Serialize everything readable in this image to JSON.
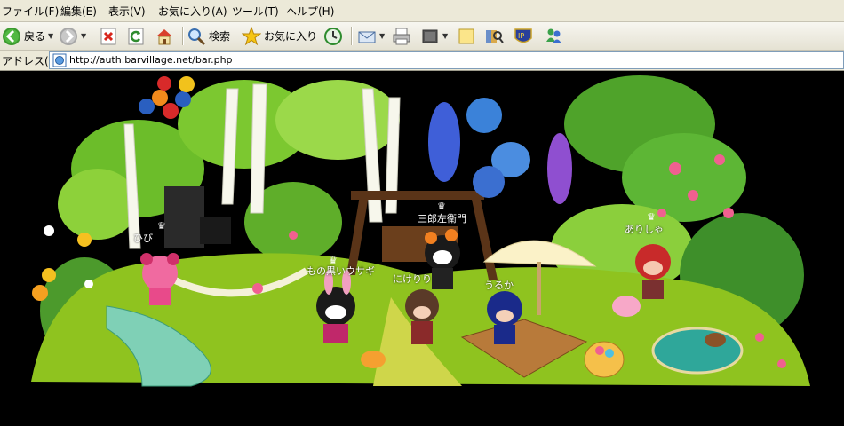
{
  "menu": {
    "items": [
      "ファイル(F)",
      "編集(E)",
      "表示(V)",
      "お気に入り(A)",
      "ツール(T)",
      "ヘルプ(H)"
    ]
  },
  "toolbar": {
    "back_label": "戻る",
    "search_label": "検索",
    "favorites_label": "お気に入り"
  },
  "address": {
    "label": "アドレス(D)",
    "url": "http://auth.barvillage.net/bar.php"
  },
  "avatars": {
    "hibi": "ひび",
    "saburo": "三郎左衛門",
    "arisha": "ありしゃ",
    "usagi": "もの黒いウサギ",
    "nike": "にけりり",
    "uruka": "うるか"
  },
  "colors": {
    "chrome": "#ece9d8",
    "grass": "#8fc31f",
    "path": "#cfd64a",
    "sky": "#000000"
  }
}
